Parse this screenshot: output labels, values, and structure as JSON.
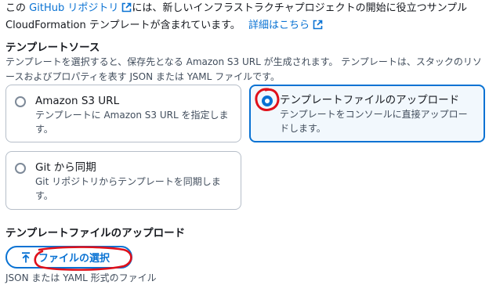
{
  "intro": {
    "prefix": "この",
    "link_text": "GitHub リポジトリ",
    "middle": "には、新しいインフラストラクチャプロジェクトの開始に役立つサンプル CloudFormation テンプレートが含まれています。",
    "details_link": "詳細はこちら"
  },
  "template_source": {
    "title": "テンプレートソース",
    "description": "テンプレートを選択すると、保存先となる Amazon S3 URL が生成されます。 テンプレートは、スタックのリソースおよびプロパティを表す JSON または YAML ファイルです。",
    "options": [
      {
        "label": "Amazon S3 URL",
        "description": "テンプレートに Amazon S3 URL を指定します。",
        "selected": false
      },
      {
        "label": "テンプレートファイルのアップロード",
        "description": "テンプレートをコンソールに直接アップロードします。",
        "selected": true
      },
      {
        "label": "Git から同期",
        "description": "Git リポジトリからテンプレートを同期します。",
        "selected": false
      }
    ]
  },
  "upload": {
    "title": "テンプレートファイルのアップロード",
    "button_label": "ファイルの選択",
    "hint": "JSON または YAML 形式のファイル"
  },
  "colors": {
    "accent": "#0972d3",
    "annotation": "#e0101a"
  },
  "icons": [
    "external-link-icon",
    "upload-arrow-icon"
  ]
}
